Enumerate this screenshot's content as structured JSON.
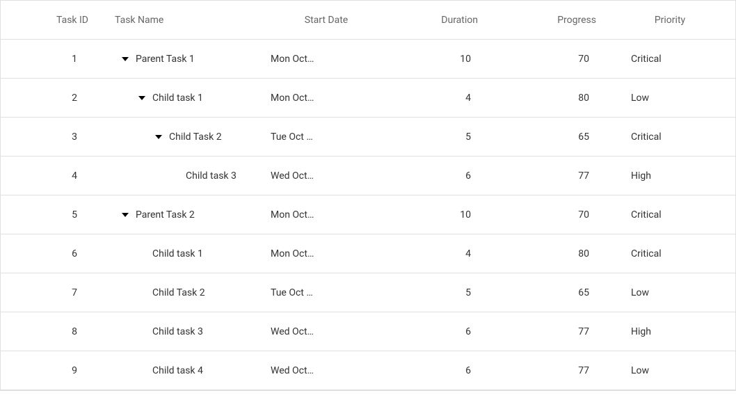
{
  "columns": {
    "taskId": "Task ID",
    "taskName": "Task Name",
    "startDate": "Start Date",
    "duration": "Duration",
    "progress": "Progress",
    "priority": "Priority"
  },
  "rows": [
    {
      "id": "1",
      "name": "Parent Task 1",
      "start": "Mon Oct…",
      "duration": "10",
      "progress": "70",
      "priority": "Critical",
      "level": 1,
      "expandable": true
    },
    {
      "id": "2",
      "name": "Child task 1",
      "start": "Mon Oct…",
      "duration": "4",
      "progress": "80",
      "priority": "Low",
      "level": 2,
      "expandable": true
    },
    {
      "id": "3",
      "name": "Child Task 2",
      "start": "Tue Oct …",
      "duration": "5",
      "progress": "65",
      "priority": "Critical",
      "level": 3,
      "expandable": true
    },
    {
      "id": "4",
      "name": "Child task 3",
      "start": "Wed Oct…",
      "duration": "6",
      "progress": "77",
      "priority": "High",
      "level": 4,
      "expandable": false
    },
    {
      "id": "5",
      "name": "Parent Task 2",
      "start": "Mon Oct…",
      "duration": "10",
      "progress": "70",
      "priority": "Critical",
      "level": 1,
      "expandable": true
    },
    {
      "id": "6",
      "name": "Child task 1",
      "start": "Mon Oct…",
      "duration": "4",
      "progress": "80",
      "priority": "Critical",
      "level": 2,
      "expandable": false
    },
    {
      "id": "7",
      "name": "Child Task 2",
      "start": "Tue Oct …",
      "duration": "5",
      "progress": "65",
      "priority": "Low",
      "level": 2,
      "expandable": false
    },
    {
      "id": "8",
      "name": "Child task 3",
      "start": "Wed Oct…",
      "duration": "6",
      "progress": "77",
      "priority": "High",
      "level": 2,
      "expandable": false
    },
    {
      "id": "9",
      "name": "Child task 4",
      "start": "Wed Oct…",
      "duration": "6",
      "progress": "77",
      "priority": "Low",
      "level": 2,
      "expandable": false
    }
  ]
}
